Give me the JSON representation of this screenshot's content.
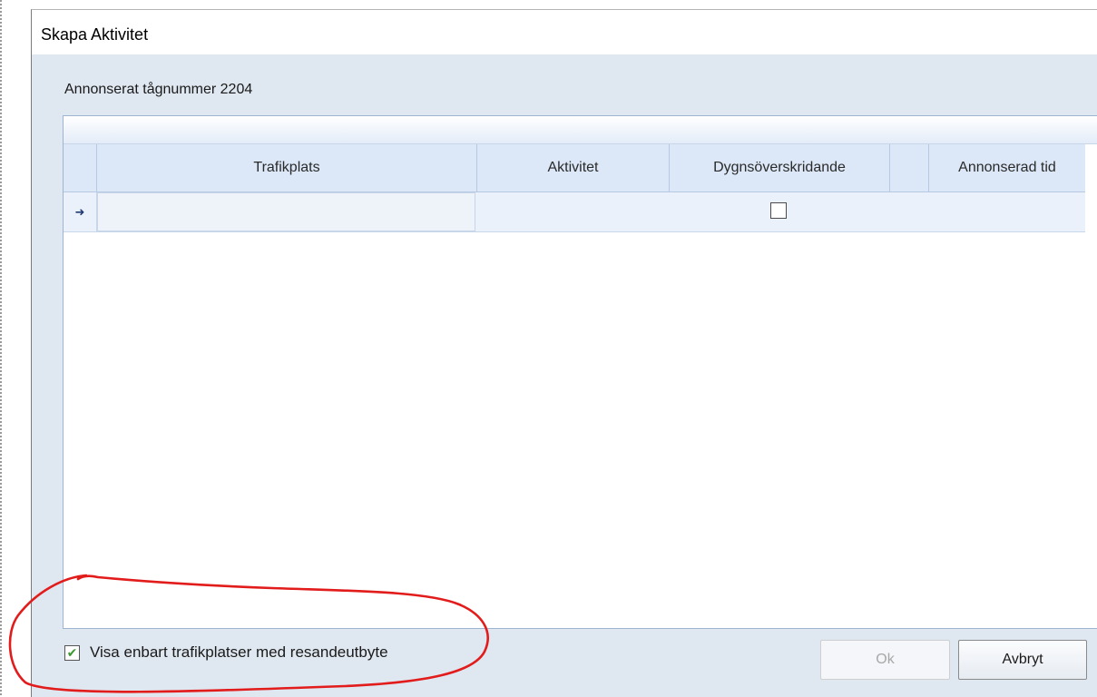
{
  "window": {
    "title": "Skapa Aktivitet"
  },
  "caption": "Annonserat tågnummer 2204",
  "grid": {
    "columns": [
      "Trafikplats",
      "Aktivitet",
      "Dygnsöverskridande",
      "",
      "Annonserad tid"
    ],
    "rows": [
      {
        "indicator": "➜",
        "trafikplats": "",
        "aktivitet": "",
        "dygnsoverskridande_checked": false,
        "annonserad_tid": ""
      }
    ]
  },
  "filter": {
    "label": "Visa enbart trafikplatser med resandeutbyte",
    "checked": true,
    "check_mark": "✔"
  },
  "buttons": {
    "ok_label": "Ok",
    "ok_enabled": false,
    "cancel_label": "Avbryt"
  },
  "colors": {
    "annotation": "#e21b1b",
    "header_bg": "#dce8f7",
    "window_bg": "#dfe7f1",
    "check_green": "#3a9a2e"
  }
}
